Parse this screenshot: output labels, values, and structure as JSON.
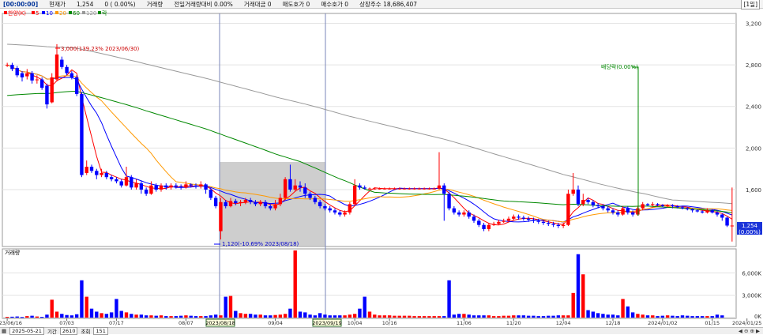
{
  "header": {
    "time": "[00:00:00]",
    "cur_label": "현재가",
    "cur_value": "1,254",
    "chg": "0 ( 0.00%)",
    "vol_label": "거래량",
    "prev_vol": "전일거래량대비 0.00%",
    "amount": "거래대금 0",
    "ask": "매도호가 0",
    "bid": "매수호가 0",
    "shares": "상장주수 18,686,407",
    "period": "[1일]"
  },
  "legend": {
    "price": "한양(K)",
    "ma5": "5",
    "ma10": "10",
    "ma20": "20",
    "ma60": "60",
    "ma120": "120",
    "extra": "락"
  },
  "volume_legend": "거래량",
  "annotations": {
    "high": "3,000(139.23% 2023/06/30)",
    "low": "1,120(-10.69% 2023/08/18)",
    "dividend": "배당락(0.00%)",
    "sel_start": "2023/08/18",
    "sel_end": "2023/09/19",
    "last_price": "1,254",
    "last_pct": "(0.00%)"
  },
  "bottom": {
    "date": "2025-05-21",
    "range_label": "기간",
    "range_value": "2610",
    "view_label": "조회",
    "view_value": "151"
  },
  "colors": {
    "up": "#ff0000",
    "down": "#0000ff",
    "ma5": "#ff0000",
    "ma10": "#0000ff",
    "ma20": "#ff9900",
    "ma60": "#008800",
    "ma120": "#999999"
  },
  "chart_data": {
    "type": "candlestick",
    "price_axis": {
      "ticks": [
        "3,200",
        "2,800",
        "2,400",
        "2,000",
        "1,600"
      ],
      "ylim": [
        1060,
        3280
      ]
    },
    "volume_axis": {
      "ticks": [
        "6,000K",
        "3,000K",
        "0K"
      ],
      "ylim": [
        0,
        9000
      ]
    },
    "x_tick_labels": [
      "2023/06/16",
      "07/03",
      "07/17",
      "08/07",
      "2023/08/18",
      "09/04",
      "2023/09/19",
      "10/04",
      "10/16",
      "11/06",
      "11/20",
      "12/04",
      "12/18",
      "2024/01/02",
      "01/15",
      "2024/01/25"
    ],
    "x_tick_index": [
      0,
      12,
      22,
      36,
      43,
      54,
      64,
      70,
      77,
      92,
      102,
      112,
      122,
      132,
      142,
      149
    ],
    "candles": [
      [
        2800,
        2800,
        2780,
        2820
      ],
      [
        2800,
        2760,
        2740,
        2820
      ],
      [
        2770,
        2700,
        2680,
        2790
      ],
      [
        2720,
        2680,
        2640,
        2740
      ],
      [
        2690,
        2720,
        2660,
        2760
      ],
      [
        2720,
        2650,
        2620,
        2740
      ],
      [
        2660,
        2660,
        2620,
        2700
      ],
      [
        2660,
        2580,
        2560,
        2680
      ],
      [
        2600,
        2420,
        2380,
        2620
      ],
      [
        2440,
        2680,
        2430,
        2720
      ],
      [
        2660,
        2900,
        2640,
        3000
      ],
      [
        2850,
        2780,
        2760,
        2880
      ],
      [
        2780,
        2720,
        2700,
        2800
      ],
      [
        2720,
        2680,
        2660,
        2740
      ],
      [
        2680,
        2520,
        2500,
        2700
      ],
      [
        2520,
        1740,
        1720,
        2540
      ],
      [
        1760,
        1820,
        1740,
        1880
      ],
      [
        1820,
        1780,
        1760,
        1840
      ],
      [
        1780,
        1740,
        1700,
        1800
      ],
      [
        1740,
        1760,
        1720,
        1800
      ],
      [
        1760,
        1720,
        1700,
        1780
      ],
      [
        1720,
        1700,
        1680,
        1740
      ],
      [
        1700,
        1680,
        1660,
        1720
      ],
      [
        1680,
        1640,
        1620,
        1700
      ],
      [
        1640,
        1720,
        1630,
        1820
      ],
      [
        1720,
        1620,
        1600,
        1740
      ],
      [
        1620,
        1660,
        1600,
        1700
      ],
      [
        1660,
        1600,
        1560,
        1680
      ],
      [
        1600,
        1560,
        1540,
        1620
      ],
      [
        1560,
        1640,
        1550,
        1680
      ],
      [
        1640,
        1600,
        1580,
        1660
      ],
      [
        1600,
        1640,
        1580,
        1660
      ],
      [
        1640,
        1620,
        1600,
        1660
      ],
      [
        1620,
        1640,
        1600,
        1660
      ],
      [
        1640,
        1630,
        1610,
        1660
      ],
      [
        1630,
        1620,
        1600,
        1650
      ],
      [
        1620,
        1650,
        1610,
        1680
      ],
      [
        1650,
        1640,
        1620,
        1660
      ],
      [
        1640,
        1630,
        1610,
        1660
      ],
      [
        1630,
        1650,
        1610,
        1680
      ],
      [
        1650,
        1600,
        1560,
        1660
      ],
      [
        1600,
        1520,
        1500,
        1620
      ],
      [
        1520,
        1440,
        1420,
        1540
      ],
      [
        1200,
        1480,
        1120,
        1520
      ],
      [
        1480,
        1440,
        1420,
        1500
      ],
      [
        1440,
        1490,
        1430,
        1520
      ],
      [
        1490,
        1470,
        1450,
        1510
      ],
      [
        1470,
        1480,
        1440,
        1500
      ],
      [
        1480,
        1500,
        1460,
        1520
      ],
      [
        1500,
        1480,
        1460,
        1520
      ],
      [
        1480,
        1460,
        1440,
        1500
      ],
      [
        1460,
        1480,
        1440,
        1500
      ],
      [
        1480,
        1440,
        1420,
        1500
      ],
      [
        1440,
        1420,
        1400,
        1460
      ],
      [
        1420,
        1460,
        1400,
        1500
      ],
      [
        1460,
        1520,
        1440,
        1560
      ],
      [
        1520,
        1700,
        1500,
        1720
      ],
      [
        1700,
        1600,
        1580,
        1840
      ],
      [
        1600,
        1640,
        1580,
        1700
      ],
      [
        1640,
        1620,
        1580,
        1680
      ],
      [
        1620,
        1560,
        1520,
        1660
      ],
      [
        1560,
        1520,
        1500,
        1580
      ],
      [
        1520,
        1480,
        1460,
        1540
      ],
      [
        1480,
        1440,
        1420,
        1500
      ],
      [
        1440,
        1420,
        1400,
        1460
      ],
      [
        1420,
        1400,
        1380,
        1440
      ],
      [
        1400,
        1380,
        1360,
        1420
      ],
      [
        1380,
        1360,
        1340,
        1400
      ],
      [
        1360,
        1380,
        1340,
        1400
      ],
      [
        1380,
        1460,
        1360,
        1480
      ],
      [
        1460,
        1640,
        1440,
        1700
      ],
      [
        1640,
        1620,
        1600,
        1660
      ],
      [
        1620,
        1610,
        1600,
        1640
      ],
      [
        1610,
        1610,
        1600,
        1620
      ],
      [
        1610,
        1610,
        1600,
        1620
      ],
      [
        1610,
        1610,
        1600,
        1620
      ],
      [
        1610,
        1610,
        1600,
        1620
      ],
      [
        1610,
        1610,
        1600,
        1620
      ],
      [
        1610,
        1610,
        1600,
        1620
      ],
      [
        1610,
        1610,
        1600,
        1620
      ],
      [
        1610,
        1610,
        1600,
        1620
      ],
      [
        1610,
        1610,
        1600,
        1620
      ],
      [
        1610,
        1610,
        1600,
        1620
      ],
      [
        1610,
        1610,
        1600,
        1620
      ],
      [
        1610,
        1610,
        1600,
        1620
      ],
      [
        1610,
        1610,
        1600,
        1620
      ],
      [
        1610,
        1610,
        1600,
        1620
      ],
      [
        1610,
        1640,
        1600,
        1960
      ],
      [
        1640,
        1560,
        1300,
        1660
      ],
      [
        1560,
        1420,
        1400,
        1580
      ],
      [
        1420,
        1380,
        1360,
        1440
      ],
      [
        1380,
        1360,
        1340,
        1400
      ],
      [
        1360,
        1380,
        1340,
        1400
      ],
      [
        1380,
        1340,
        1320,
        1400
      ],
      [
        1340,
        1300,
        1280,
        1360
      ],
      [
        1300,
        1260,
        1240,
        1320
      ],
      [
        1260,
        1220,
        1200,
        1280
      ],
      [
        1220,
        1260,
        1200,
        1280
      ],
      [
        1260,
        1270,
        1250,
        1290
      ],
      [
        1270,
        1290,
        1260,
        1310
      ],
      [
        1290,
        1300,
        1280,
        1320
      ],
      [
        1300,
        1320,
        1290,
        1340
      ],
      [
        1320,
        1340,
        1300,
        1360
      ],
      [
        1340,
        1330,
        1310,
        1360
      ],
      [
        1330,
        1320,
        1300,
        1350
      ],
      [
        1320,
        1310,
        1290,
        1340
      ],
      [
        1310,
        1300,
        1280,
        1330
      ],
      [
        1300,
        1290,
        1270,
        1320
      ],
      [
        1290,
        1280,
        1260,
        1310
      ],
      [
        1280,
        1270,
        1250,
        1300
      ],
      [
        1270,
        1260,
        1240,
        1290
      ],
      [
        1260,
        1250,
        1230,
        1280
      ],
      [
        1250,
        1260,
        1230,
        1280
      ],
      [
        1260,
        1560,
        1250,
        1600
      ],
      [
        1560,
        1600,
        1540,
        1760
      ],
      [
        1600,
        1460,
        1440,
        1640
      ],
      [
        1460,
        1500,
        1440,
        1560
      ],
      [
        1500,
        1480,
        1460,
        1520
      ],
      [
        1480,
        1450,
        1430,
        1500
      ],
      [
        1450,
        1440,
        1420,
        1470
      ],
      [
        1440,
        1420,
        1400,
        1460
      ],
      [
        1420,
        1400,
        1380,
        1440
      ],
      [
        1400,
        1380,
        1360,
        1420
      ],
      [
        1380,
        1360,
        1340,
        1400
      ],
      [
        1360,
        1420,
        1350,
        1440
      ],
      [
        1420,
        1380,
        1360,
        1440
      ],
      [
        1380,
        1360,
        1340,
        1400
      ],
      [
        1360,
        1420,
        1350,
        1440
      ],
      [
        1420,
        1460,
        1400,
        1480
      ],
      [
        1460,
        1450,
        1440,
        1470
      ],
      [
        1450,
        1460,
        1440,
        1480
      ],
      [
        1460,
        1450,
        1440,
        1470
      ],
      [
        1450,
        1440,
        1430,
        1460
      ],
      [
        1440,
        1450,
        1430,
        1460
      ],
      [
        1450,
        1440,
        1420,
        1460
      ],
      [
        1440,
        1430,
        1420,
        1450
      ],
      [
        1430,
        1420,
        1410,
        1440
      ],
      [
        1420,
        1410,
        1400,
        1430
      ],
      [
        1410,
        1400,
        1380,
        1420
      ],
      [
        1400,
        1390,
        1380,
        1410
      ],
      [
        1390,
        1380,
        1370,
        1400
      ],
      [
        1380,
        1400,
        1370,
        1420
      ],
      [
        1400,
        1380,
        1370,
        1410
      ],
      [
        1380,
        1360,
        1340,
        1390
      ],
      [
        1360,
        1330,
        1300,
        1370
      ],
      [
        1330,
        1254,
        1240,
        1340
      ],
      [
        1254,
        1254,
        1100,
        1620
      ]
    ],
    "volume_k": [
      100,
      120,
      150,
      80,
      200,
      250,
      150,
      100,
      400,
      2400,
      800,
      500,
      350,
      300,
      450,
      5000,
      2800,
      1200,
      800,
      600,
      500,
      700,
      2500,
      900,
      700,
      500,
      400,
      400,
      300,
      300,
      250,
      300,
      200,
      200,
      200,
      250,
      300,
      250,
      200,
      200,
      200,
      300,
      400,
      300,
      2800,
      2900,
      900,
      600,
      500,
      500,
      400,
      400,
      300,
      300,
      350,
      400,
      500,
      1200,
      9000,
      800,
      700,
      400,
      300,
      600,
      400,
      300,
      300,
      300,
      300,
      400,
      500,
      1200,
      2800,
      800,
      400,
      300,
      300,
      300,
      250,
      250,
      250,
      250,
      200,
      200,
      200,
      200,
      200,
      200,
      200,
      5000,
      400,
      500,
      500,
      400,
      300,
      300,
      300,
      300,
      200,
      200,
      250,
      250,
      300,
      300,
      300,
      250,
      250,
      200,
      200,
      250,
      250,
      300,
      300,
      300,
      3300,
      8500,
      5800,
      1000,
      800,
      600,
      500,
      400,
      400,
      300,
      2500,
      1500,
      700,
      500,
      400,
      300,
      300,
      200,
      250,
      300,
      250,
      200,
      300,
      250,
      200,
      200,
      200,
      200,
      200,
      400,
      300
    ]
  }
}
